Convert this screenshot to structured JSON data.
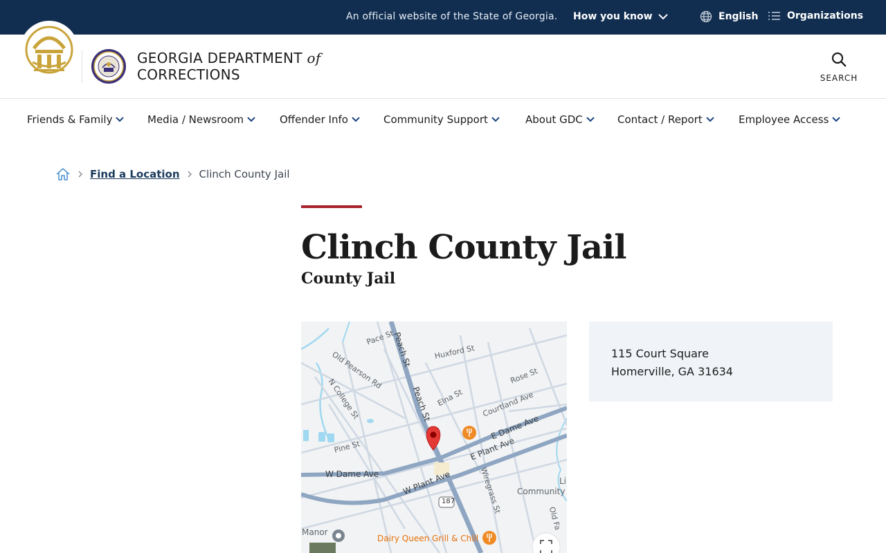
{
  "banner": {
    "official_text": "An official website of the State of Georgia.",
    "how_you_know": "How you know",
    "language": "English",
    "organizations": "Organizations"
  },
  "header": {
    "agency_line1": "GEORGIA DEPARTMENT",
    "agency_of": "of",
    "agency_line2": "CORRECTIONS",
    "search_label": "SEARCH"
  },
  "nav": {
    "items": [
      {
        "label": "Friends & Family"
      },
      {
        "label": "Media / Newsroom"
      },
      {
        "label": "Offender Info"
      },
      {
        "label": "Community Support"
      },
      {
        "label": "About GDC"
      },
      {
        "label": "Contact / Report"
      },
      {
        "label": "Employee Access"
      }
    ]
  },
  "breadcrumb": {
    "home_icon": "home-icon",
    "items": [
      {
        "label": "Find a Location"
      },
      {
        "label": "Clinch County Jail"
      }
    ]
  },
  "page": {
    "title": "Clinch County Jail",
    "subtitle": "County Jail"
  },
  "address": {
    "line1": "115 Court Square",
    "line2": "Homerville, GA 31634"
  },
  "map": {
    "labels": {
      "pace_st": "Pace St",
      "peach_st_1": "Peach St",
      "peach_st_2": "Peach St",
      "huxford_st": "Huxford St",
      "old_pearson_rd": "Old Pearson Rd",
      "n_college_st": "N College St",
      "rose_st": "Rose St",
      "elna_st": "Elna St",
      "courtland_ave": "Courtland Ave",
      "e_dame_ave": "E Dame Ave",
      "pine_st": "Pine St",
      "e_plant_ave": "E Plant Ave",
      "w_dame_ave": "W Dame Ave",
      "w_plant_ave": "W Plant Ave",
      "wiregrass_st": "Wiregrass St",
      "route_187": "187",
      "community": "Community",
      "li": "Li",
      "old_fa": "Old Fa",
      "manor": "Manor",
      "dairy_queen": "Dairy Queen Grill & Chill"
    }
  },
  "colors": {
    "banner_bg": "#112e51",
    "accent_red": "#a8212b",
    "seal_gold": "#c9a43a",
    "address_bg": "#f0f4f8"
  }
}
